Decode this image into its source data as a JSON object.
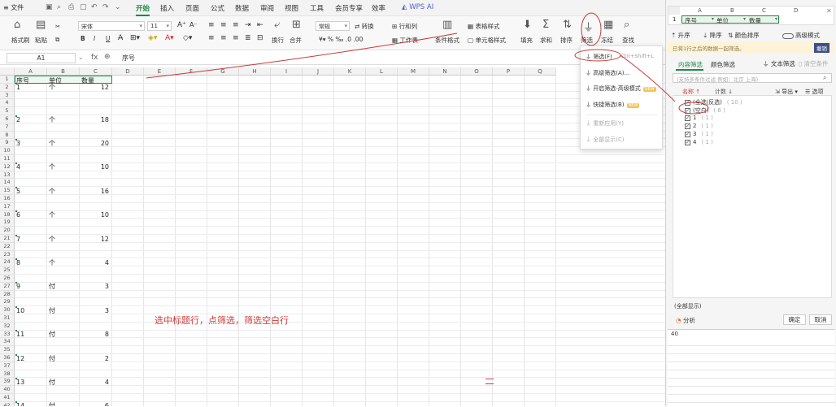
{
  "menubar": {
    "file": "文件",
    "tabs": [
      "开始",
      "插入",
      "页面",
      "公式",
      "数据",
      "审阅",
      "视图",
      "工具",
      "会员专享",
      "效率"
    ],
    "active": "开始",
    "wps_ai": "WPS AI"
  },
  "ribbon": {
    "format_painter": "格式刷",
    "paste": "粘贴",
    "font_name": "宋体",
    "font_size": "11",
    "bold": "B",
    "italic": "I",
    "underline": "U",
    "wrap": "换行",
    "merge": "合并",
    "number_format": "常规",
    "convert": "转换",
    "row_col": "行和列",
    "worksheet": "工作表",
    "cond_format": "条件格式",
    "table_style": "表格样式",
    "cell_style": "单元格样式",
    "fill": "填充",
    "sum": "求和",
    "sort": "排序",
    "filter": "筛选",
    "freeze": "冻结",
    "find": "查找"
  },
  "formula_bar": {
    "name_box": "A1",
    "fx": "fx",
    "content": "序号"
  },
  "columns": [
    "A",
    "B",
    "C",
    "D",
    "E",
    "F",
    "G",
    "H",
    "I",
    "J",
    "K",
    "L",
    "M",
    "N",
    "O",
    "P",
    "Q"
  ],
  "headers": [
    "序号",
    "单位",
    "数量"
  ],
  "rows": [
    {
      "n": "1",
      "a": "1",
      "b": "个",
      "c": "12"
    },
    {
      "n": "5",
      "a": "2",
      "b": "个",
      "c": "18"
    },
    {
      "n": "8",
      "a": "3",
      "b": "个",
      "c": "20"
    },
    {
      "n": "11",
      "a": "4",
      "b": "个",
      "c": "10"
    },
    {
      "n": "14",
      "a": "5",
      "b": "个",
      "c": "16"
    },
    {
      "n": "17",
      "a": "6",
      "b": "个",
      "c": "10"
    },
    {
      "n": "20",
      "a": "7",
      "b": "个",
      "c": "12"
    },
    {
      "n": "23",
      "a": "8",
      "b": "个",
      "c": "4"
    },
    {
      "n": "26",
      "a": "9",
      "b": "付",
      "c": "3"
    },
    {
      "n": "29",
      "a": "10",
      "b": "付",
      "c": "3"
    },
    {
      "n": "32",
      "a": "11",
      "b": "付",
      "c": "8"
    },
    {
      "n": "35",
      "a": "12",
      "b": "付",
      "c": "2"
    },
    {
      "n": "38",
      "a": "13",
      "b": "付",
      "c": "4"
    },
    {
      "n": "41",
      "a": "14",
      "b": "付",
      "c": "6"
    }
  ],
  "row_numbers": [
    "1",
    "2",
    "3",
    "4",
    "5",
    "6",
    "7",
    "8",
    "9",
    "10",
    "11",
    "12",
    "13",
    "14",
    "15",
    "16",
    "17",
    "18",
    "19",
    "20",
    "21",
    "22",
    "23",
    "24",
    "25",
    "26",
    "27",
    "28",
    "29",
    "30",
    "31",
    "32",
    "33",
    "34",
    "35",
    "36",
    "37",
    "38",
    "39",
    "40",
    "41",
    "42"
  ],
  "annotation": "选中标题行，点筛选，筛选空白行",
  "dropdown": {
    "items": [
      {
        "label": "筛选(F)",
        "shortcut": "Ctrl+Shift+L",
        "disabled": false
      },
      {
        "label": "高级筛选(A)...",
        "shortcut": "",
        "disabled": false
      },
      {
        "label": "开启筛选-高级模式",
        "shortcut": "",
        "disabled": false,
        "badge": "NEW"
      },
      {
        "label": "快捷筛选(B)",
        "shortcut": "",
        "disabled": false,
        "badge": "NEW"
      },
      {
        "label": "重新应用(Y)",
        "shortcut": "",
        "disabled": true
      },
      {
        "label": "全部显示(C)",
        "shortcut": "",
        "disabled": true
      }
    ]
  },
  "panel": {
    "mini_cols": [
      "A",
      "B",
      "C",
      "D"
    ],
    "mini_headers": [
      "序号",
      "单位",
      "数量"
    ],
    "sort_asc": "升序",
    "sort_desc": "降序",
    "color_sort": "颜色排序",
    "advanced_mode": "高级模式",
    "notice": "已将1行之后的数据一起筛选。",
    "cancel_notice": "撤销",
    "tab_content": "内容筛选",
    "tab_color": "颜色筛选",
    "text_filter": "文本筛选",
    "clear": "清空条件",
    "search_placeholder": "(支持多条件过滤  例如：北京 上海)",
    "col_name": "名称 ↑",
    "col_count": "计数 ↓",
    "export": "导出",
    "options": "选项",
    "items": [
      {
        "label": "(全选|反选)",
        "count": "( 10 )"
      },
      {
        "label": "(空白)",
        "count": "( 6 )"
      },
      {
        "label": "1",
        "count": "( 1 )"
      },
      {
        "label": "2",
        "count": "( 1 )"
      },
      {
        "label": "3",
        "count": "( 1 )"
      },
      {
        "label": "4",
        "count": "( 1 )"
      }
    ],
    "show_all": "(全部显示)",
    "analyze": "分析",
    "ok": "确定",
    "cancel": "取消",
    "row_40": "40"
  }
}
